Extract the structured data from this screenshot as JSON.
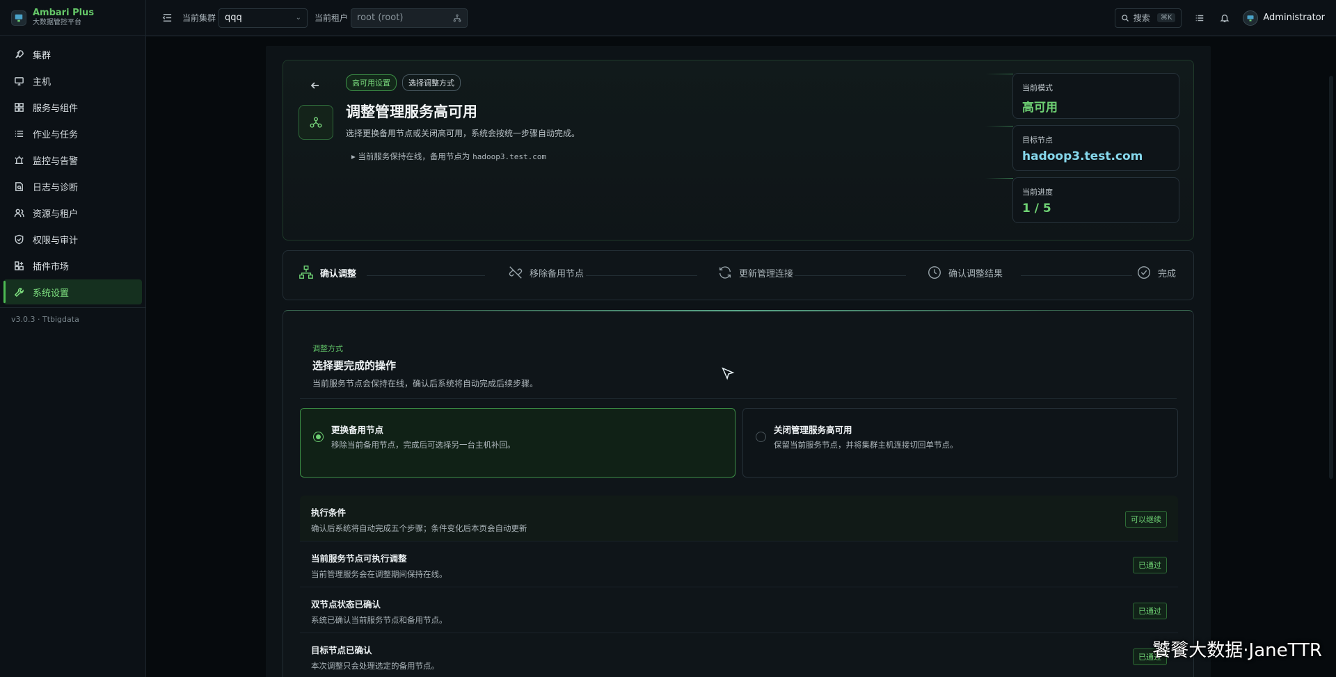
{
  "brand": {
    "name": "Ambari Plus",
    "subtitle": "大数据管控平台"
  },
  "sidebar": {
    "items": [
      {
        "label": "集群"
      },
      {
        "label": "主机"
      },
      {
        "label": "服务与组件"
      },
      {
        "label": "作业与任务"
      },
      {
        "label": "监控与告警"
      },
      {
        "label": "日志与诊断"
      },
      {
        "label": "资源与租户"
      },
      {
        "label": "权限与审计"
      },
      {
        "label": "插件市场"
      },
      {
        "label": "系统设置"
      }
    ],
    "version": "v3.0.3 · Ttbigdata"
  },
  "topbar": {
    "cluster_label": "当前集群",
    "cluster_value": "qqq",
    "tenant_label": "当前租户",
    "tenant_value": "root (root)",
    "search_label": "搜索",
    "search_shortcut": "⌘K",
    "user": "Administrator"
  },
  "hero": {
    "tags": [
      "高可用设置",
      "选择调整方式"
    ],
    "title": "调整管理服务高可用",
    "description": "选择更换备用节点或关闭高可用，系统会按统一步骤自动完成。",
    "note_prefix": "当前服务保持在线，备用节点为",
    "note_host": "hadoop3.test.com",
    "stats": [
      {
        "label": "当前模式",
        "value": "高可用"
      },
      {
        "label": "目标节点",
        "value": "hadoop3.test.com"
      },
      {
        "label": "当前进度",
        "value": "1 / 5"
      }
    ]
  },
  "steps": [
    "确认调整",
    "移除备用节点",
    "更新管理连接",
    "确认调整结果",
    "完成"
  ],
  "panel": {
    "kicker": "调整方式",
    "title": "选择要完成的操作",
    "description": "当前服务节点会保持在线，确认后系统将自动完成后续步骤。",
    "options": [
      {
        "title": "更换备用节点",
        "desc": "移除当前备用节点，完成后可选择另一台主机补回。"
      },
      {
        "title": "关闭管理服务高可用",
        "desc": "保留当前服务节点，并将集群主机连接切回单节点。"
      }
    ],
    "conditions": [
      {
        "title": "执行条件",
        "desc": "确认后系统将自动完成五个步骤；条件变化后本页会自动更新",
        "badge": "可以继续"
      },
      {
        "title": "当前服务节点可执行调整",
        "desc": "当前管理服务会在调整期间保持在线。",
        "badge": "已通过"
      },
      {
        "title": "双节点状态已确认",
        "desc": "系统已确认当前服务节点和备用节点。",
        "badge": "已通过"
      },
      {
        "title": "目标节点已确认",
        "desc": "本次调整只会处理选定的备用节点。",
        "badge": "已通过"
      }
    ]
  },
  "watermark": "饕餮大数据·JaneTTR",
  "colors": {
    "accent": "#6fd274",
    "cyan": "#86d8ec",
    "bg": "#0b1014"
  }
}
